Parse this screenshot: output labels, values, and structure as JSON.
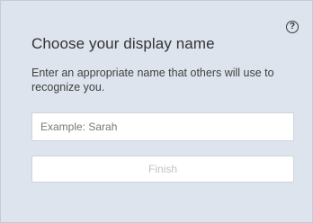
{
  "dialog": {
    "title": "Choose your display name",
    "description": "Enter an appropriate name that others will use to recognize you.",
    "help_icon_glyph": "?",
    "name_input": {
      "value": "",
      "placeholder": "Example: Sarah"
    },
    "finish_label": "Finish",
    "finish_enabled": false
  },
  "icons": {
    "help": "help-icon"
  },
  "colors": {
    "background": "#dde4ee",
    "title": "#333333",
    "disabled_text": "#c2c2c2",
    "field_border": "#cfd3d8"
  }
}
